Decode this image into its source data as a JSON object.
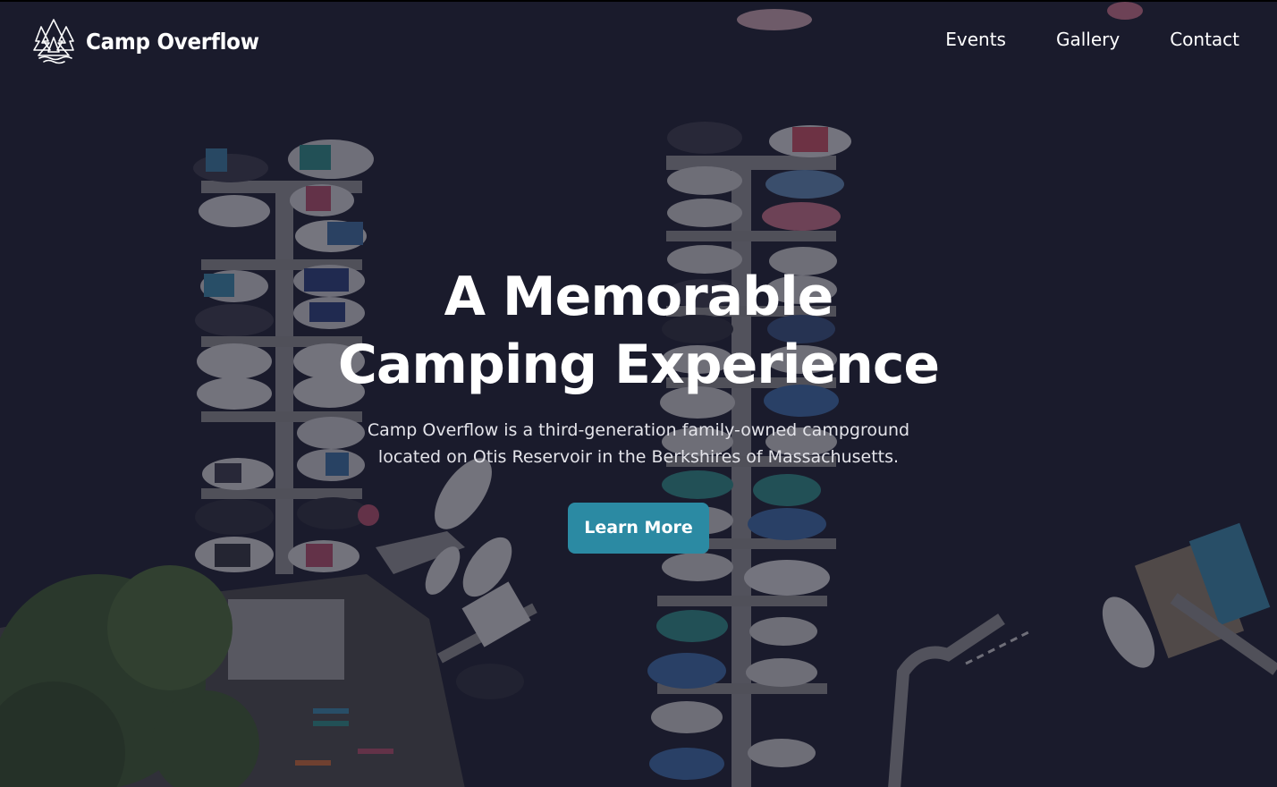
{
  "header": {
    "brand_name": "Camp Overflow",
    "logo_icon": "pine-trees-water-icon",
    "nav": [
      "Events",
      "Gallery",
      "Contact"
    ]
  },
  "hero": {
    "headline_line1": "A Memorable",
    "headline_line2": "Camping Experience",
    "tagline_line1": "Camp Overflow is a third-generation family-owned campground",
    "tagline_line2": "located on Otis Reservoir in the Berkshires of Massachusetts.",
    "cta_label": "Learn More",
    "background": "aerial-photo-boat-docks"
  },
  "colors": {
    "accent": "#2b8aa3",
    "water": "#1b1c2a",
    "text": "#ffffff"
  }
}
